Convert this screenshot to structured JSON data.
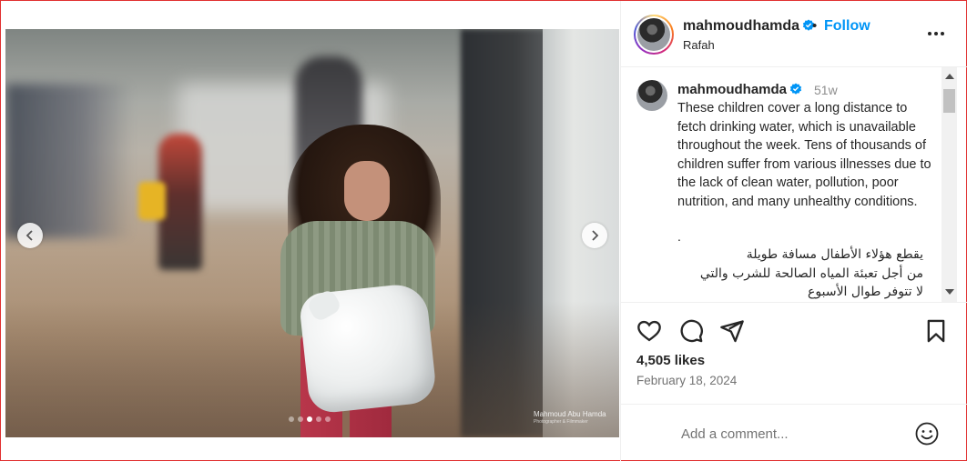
{
  "post": {
    "username": "mahmoudhamda",
    "follow_label": "Follow",
    "bullet": "•",
    "location": "Rafah"
  },
  "media": {
    "watermark_name": "Mahmoud Abu Hamda",
    "watermark_sub": "Photographer & Filmmaker",
    "slide_count": 5,
    "active_slide": 3
  },
  "caption": {
    "username": "mahmoudhamda",
    "time_ago": "51w",
    "text_en": "These children cover a long distance to fetch drinking water, which is unavailable throughout the week. Tens of thousands of children suffer from various illnesses due to the lack of clean water, pollution, poor nutrition, and many unhealthy conditions.",
    "separator": ".",
    "text_ar_1": "يقطع هؤلاء الأطفال مسافة طويلة",
    "text_ar_2": "من أجل تعبئة المياه الصالحة للشرب والتي",
    "text_ar_3": "لا تتوفر طوال الأسبوع"
  },
  "stats": {
    "likes": "4,505 likes",
    "date": "February 18, 2024"
  },
  "comment_box": {
    "placeholder": "Add a comment..."
  },
  "icons": {
    "verified": "verified-badge-icon",
    "more": "more-options-icon",
    "like": "heart-icon",
    "comment": "comment-icon",
    "share": "share-icon",
    "save": "bookmark-icon",
    "emoji": "emoji-icon",
    "prev": "chevron-left-icon",
    "next": "chevron-right-icon"
  },
  "colors": {
    "accent": "#0095f6",
    "verified": "#0095f6",
    "text": "#262626",
    "muted": "#737373",
    "window_border": "#e03030"
  }
}
